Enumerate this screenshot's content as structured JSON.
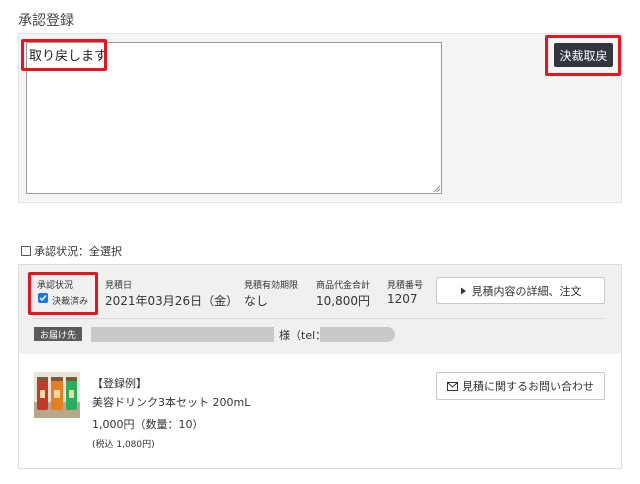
{
  "approval": {
    "title": "承認登録",
    "remark_text": "取り戻します",
    "revert_button": "決裁取戻"
  },
  "select_all_label": "承認状況：全選択",
  "order": {
    "status_label": "承認状況",
    "status_value": "決裁済み",
    "status_checked": true,
    "date_label": "見積日",
    "date_value": "2021年03月26日（金）",
    "expiry_label": "見積有効期限",
    "expiry_value": "なし",
    "total_label": "商品代金合計",
    "total_value": "10,800円",
    "number_label": "見積番号",
    "number_value": "1207",
    "detail_button": "見積内容の詳細、注文",
    "delivery_badge": "お届け先",
    "recipient_suffix": "様（tel：",
    "product": {
      "example_label": "【登録例】",
      "name": "美容ドリンク3本セット 200mL",
      "price": "1,000円（数量：10）",
      "tax_note": "(税込 1,080円)"
    },
    "inquiry_button": "見積に関するお問い合わせ"
  },
  "colors": {
    "highlight": "#e8141e",
    "dark_button": "#2f3640",
    "checkbox_blue": "#1a73e8"
  },
  "icons": [
    "triangle-right-icon",
    "envelope-icon",
    "checkbox-icon",
    "resize-grip-icon"
  ]
}
